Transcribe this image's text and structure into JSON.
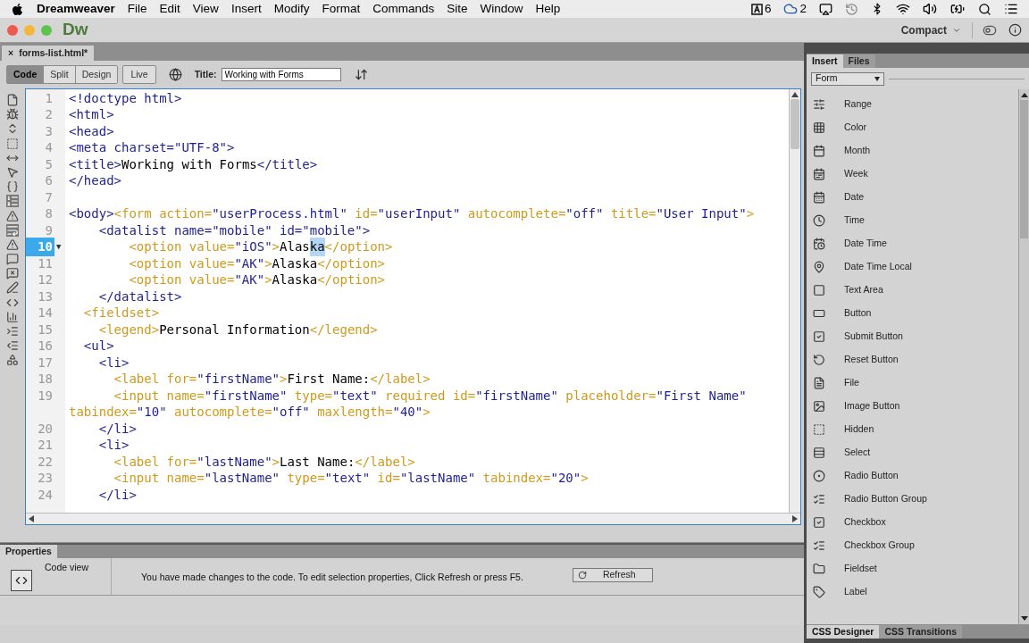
{
  "menu_bar": {
    "app": "Dreamweaver",
    "items": [
      "File",
      "Edit",
      "View",
      "Insert",
      "Modify",
      "Format",
      "Commands",
      "Site",
      "Window",
      "Help"
    ],
    "adobe_count": "6",
    "cloud_count": "2"
  },
  "title_bar": {
    "logo": "Dw",
    "workspace": "Compact"
  },
  "document_tab": {
    "label": "forms-list.html*",
    "close": "×"
  },
  "view_buttons": [
    {
      "label": "Code",
      "selected": true
    },
    {
      "label": "Split",
      "selected": false
    },
    {
      "label": "Design",
      "selected": false
    }
  ],
  "live_button": {
    "label": "Live",
    "selected": false
  },
  "title_field": {
    "label": "Title:",
    "value": "Working with Forms"
  },
  "code": {
    "lines": [
      {
        "number": "1",
        "segments": [
          {
            "kind": "tag",
            "text": "<!doctype html>"
          }
        ]
      },
      {
        "number": "2",
        "segments": [
          {
            "kind": "tag",
            "text": "<html>"
          }
        ]
      },
      {
        "number": "3",
        "segments": [
          {
            "kind": "tag",
            "text": "<head>"
          }
        ]
      },
      {
        "number": "4",
        "segments": [
          {
            "kind": "tag",
            "text": "<meta charset=\"UTF-8\">"
          }
        ]
      },
      {
        "number": "5",
        "segments": [
          {
            "kind": "tag",
            "text": "<title>"
          },
          {
            "kind": "text",
            "text": "Working with Forms"
          },
          {
            "kind": "tag",
            "text": "</title>"
          }
        ]
      },
      {
        "number": "6",
        "segments": [
          {
            "kind": "tag",
            "text": "</head>"
          }
        ]
      },
      {
        "number": "7"
      },
      {
        "number": "8",
        "segments": [
          {
            "kind": "tag",
            "text": "<body>"
          },
          {
            "kind": "form",
            "text": "<form action="
          },
          {
            "kind": "tag",
            "text": "\"userProcess.html\""
          },
          {
            "kind": "form",
            "text": " id="
          },
          {
            "kind": "tag",
            "text": "\"userInput\""
          },
          {
            "kind": "form",
            "text": " autocomplete="
          },
          {
            "kind": "tag",
            "text": "\"off\""
          },
          {
            "kind": "form",
            "text": " title="
          },
          {
            "kind": "tag",
            "text": "\"User Input\""
          },
          {
            "kind": "form",
            "text": ">"
          }
        ]
      },
      {
        "number": "9",
        "segments": [
          {
            "kind": "tag",
            "text": "    <datalist name=\"mobile\" id=\"mobile\">"
          }
        ]
      },
      {
        "number": "10",
        "current": true,
        "fold_marker": "▼",
        "segments": [
          {
            "kind": "form",
            "text": "        <option value="
          },
          {
            "kind": "tag",
            "text": "\"iOS\""
          },
          {
            "kind": "form",
            "text": ">"
          },
          {
            "kind": "text",
            "text": "Alas"
          },
          {
            "kind": "selection",
            "text": "ka"
          },
          {
            "kind": "form",
            "text": "</option>"
          }
        ]
      },
      {
        "number": "11",
        "segments": [
          {
            "kind": "form",
            "text": "        <option value="
          },
          {
            "kind": "tag",
            "text": "\"AK\""
          },
          {
            "kind": "form",
            "text": ">"
          },
          {
            "kind": "text",
            "text": "Alaska"
          },
          {
            "kind": "form",
            "text": "</option>"
          }
        ]
      },
      {
        "number": "12",
        "segments": [
          {
            "kind": "form",
            "text": "        <option value="
          },
          {
            "kind": "tag",
            "text": "\"AK\""
          },
          {
            "kind": "form",
            "text": ">"
          },
          {
            "kind": "text",
            "text": "Alaska"
          },
          {
            "kind": "form",
            "text": "</option>"
          }
        ]
      },
      {
        "number": "13",
        "segments": [
          {
            "kind": "tag",
            "text": "    </datalist>"
          }
        ]
      },
      {
        "number": "14",
        "segments": [
          {
            "kind": "form",
            "text": "  <fieldset>"
          }
        ]
      },
      {
        "number": "15",
        "segments": [
          {
            "kind": "form",
            "text": "    <legend>"
          },
          {
            "kind": "text",
            "text": "Personal Information"
          },
          {
            "kind": "form",
            "text": "</legend>"
          }
        ]
      },
      {
        "number": "16",
        "segments": [
          {
            "kind": "tag",
            "text": "  <ul>"
          }
        ]
      },
      {
        "number": "17",
        "segments": [
          {
            "kind": "tag",
            "text": "    <li>"
          }
        ]
      },
      {
        "number": "18",
        "segments": [
          {
            "kind": "form",
            "text": "      <label for="
          },
          {
            "kind": "tag",
            "text": "\"firstName\""
          },
          {
            "kind": "form",
            "text": ">"
          },
          {
            "kind": "text",
            "text": "First Name:"
          },
          {
            "kind": "form",
            "text": "</label>"
          }
        ]
      },
      {
        "number": "19",
        "segments": [
          {
            "kind": "form",
            "text": "      <input name="
          },
          {
            "kind": "tag",
            "text": "\"firstName\""
          },
          {
            "kind": "form",
            "text": " type="
          },
          {
            "kind": "tag",
            "text": "\"text\""
          },
          {
            "kind": "form",
            "text": " required id="
          },
          {
            "kind": "tag",
            "text": "\"firstName\""
          },
          {
            "kind": "form",
            "text": " placeholder="
          },
          {
            "kind": "tag",
            "text": "\"First Name\""
          }
        ]
      },
      {
        "segments": [
          {
            "kind": "form",
            "text": "tabindex="
          },
          {
            "kind": "tag",
            "text": "\"10\""
          },
          {
            "kind": "form",
            "text": " autocomplete="
          },
          {
            "kind": "tag",
            "text": "\"off\""
          },
          {
            "kind": "form",
            "text": " maxlength="
          },
          {
            "kind": "tag",
            "text": "\"40\""
          },
          {
            "kind": "form",
            "text": ">"
          }
        ]
      },
      {
        "number": "20",
        "segments": [
          {
            "kind": "tag",
            "text": "    </li>"
          }
        ]
      },
      {
        "number": "21",
        "segments": [
          {
            "kind": "tag",
            "text": "    <li>"
          }
        ]
      },
      {
        "number": "22",
        "segments": [
          {
            "kind": "form",
            "text": "      <label for="
          },
          {
            "kind": "tag",
            "text": "\"lastName\""
          },
          {
            "kind": "form",
            "text": ">"
          },
          {
            "kind": "text",
            "text": "Last Name:"
          },
          {
            "kind": "form",
            "text": "</label>"
          }
        ]
      },
      {
        "number": "23",
        "segments": [
          {
            "kind": "form",
            "text": "      <input name="
          },
          {
            "kind": "tag",
            "text": "\"lastName\""
          },
          {
            "kind": "form",
            "text": " type="
          },
          {
            "kind": "tag",
            "text": "\"text\""
          },
          {
            "kind": "form",
            "text": " id="
          },
          {
            "kind": "tag",
            "text": "\"lastName\""
          },
          {
            "kind": "form",
            "text": " tabindex="
          },
          {
            "kind": "tag",
            "text": "\"20\""
          },
          {
            "kind": "form",
            "text": ">"
          }
        ]
      },
      {
        "number": "24",
        "segments": [
          {
            "kind": "tag",
            "text": "    </li>"
          }
        ]
      }
    ]
  },
  "properties": {
    "tab": "Properties",
    "view_label": "Code view",
    "message": "You have made changes to the code. To edit selection properties, Click Refresh or press F5.",
    "button": "Refresh"
  },
  "insert_panel": {
    "tabs": [
      {
        "label": "Insert",
        "selected": true
      },
      {
        "label": "Files",
        "selected": false
      }
    ],
    "category": "Form",
    "items": [
      "Range",
      "Color",
      "Month",
      "Week",
      "Date",
      "Time",
      "Date Time",
      "Date Time Local",
      "Text Area",
      "Button",
      "Submit Button",
      "Reset Button",
      "File",
      "Image Button",
      "Hidden",
      "Select",
      "Radio Button",
      "Radio Button Group",
      "Checkbox",
      "Checkbox Group",
      "Fieldset",
      "Label"
    ]
  },
  "bottom_tabs": [
    {
      "label": "CSS Designer",
      "selected": true
    },
    {
      "label": "CSS Transitions",
      "selected": false
    }
  ]
}
